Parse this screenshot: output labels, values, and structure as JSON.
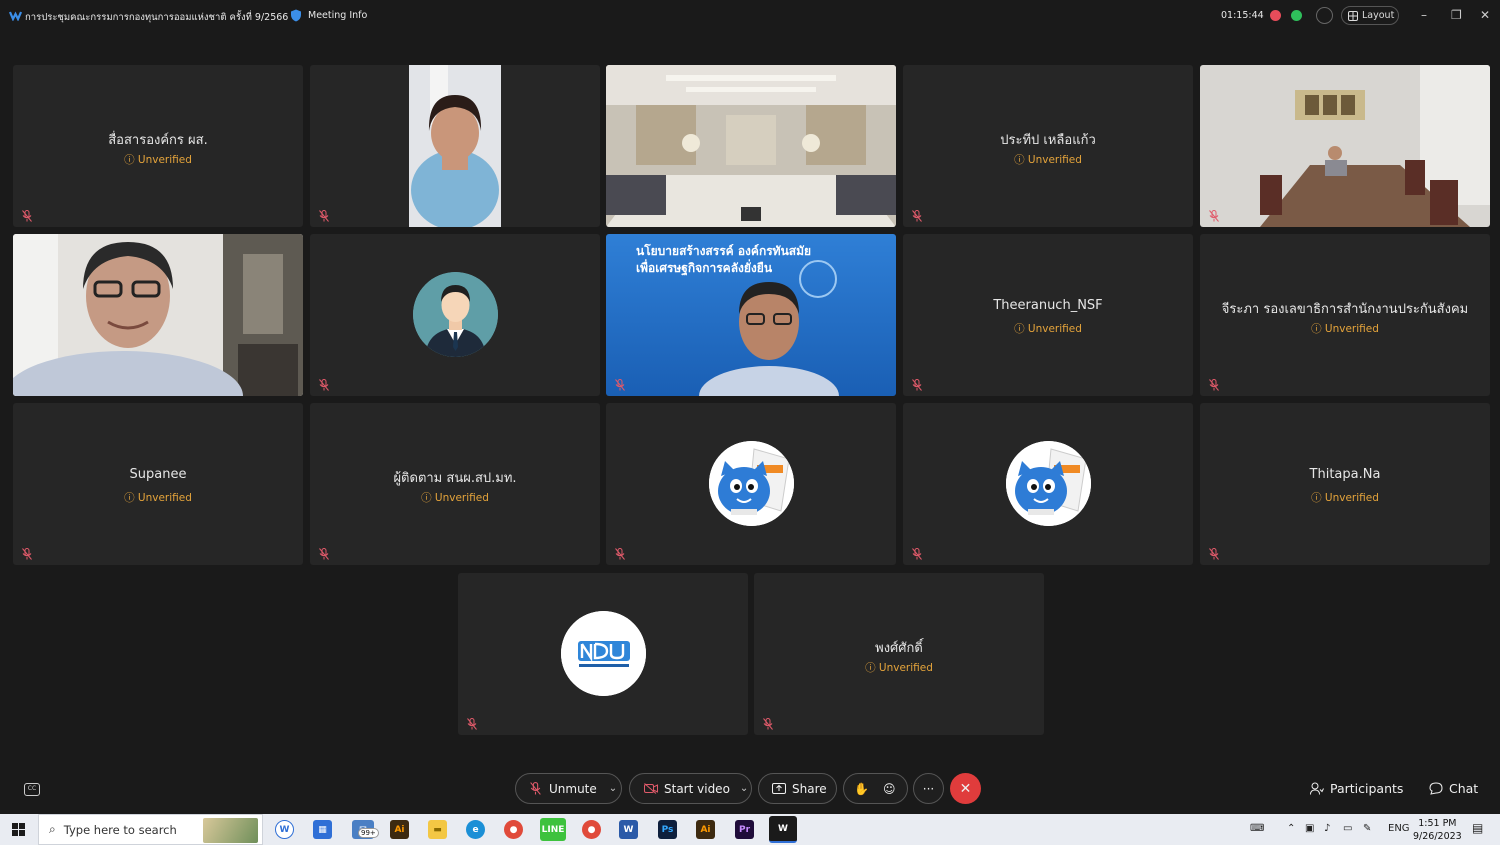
{
  "titlebar": {
    "meeting_title": "การประชุมคณะกรรมการกองทุนการออมแห่งชาติ ครั้งที่ 9/2566",
    "meeting_info": "Meeting Info",
    "timer": "01:15:44",
    "layout_label": "Layout"
  },
  "unverified_label": "Unverified",
  "tiles": {
    "t1": {
      "name": "สื่อสารองค์กร ผส."
    },
    "t4": {
      "name": "ประทีป เหลือแก้ว"
    },
    "t8": {
      "banner1": "นโยบายสร้างสรรค์ องค์กรทันสมัย",
      "banner2": "เพื่อเศรษฐกิจการคลังยั่งยืน"
    },
    "t9": {
      "name": "Theeranuch_NSF"
    },
    "t10": {
      "name": "จีระภา รองเลขาธิการสำนักงานประกันสังคม"
    },
    "t11": {
      "name": "Supanee"
    },
    "t12": {
      "name": "ผู้ติดตาม สนผ.สป.มท."
    },
    "t15": {
      "name": "Thitapa.Na"
    },
    "t17": {
      "name": "พงศ์ศักดิ์"
    }
  },
  "controls": {
    "unmute": "Unmute",
    "start_video": "Start video",
    "share": "Share",
    "participants": "Participants",
    "chat": "Chat"
  },
  "taskbar": {
    "search_placeholder": "Type here to search",
    "badge": "99+",
    "lang": "ENG",
    "time": "1:51 PM",
    "date": "9/26/2023"
  },
  "colors": {
    "unverified": "#e5a43b",
    "leave": "#e03c3c",
    "tile_bg": "#262626",
    "background": "#1a1a1a"
  }
}
